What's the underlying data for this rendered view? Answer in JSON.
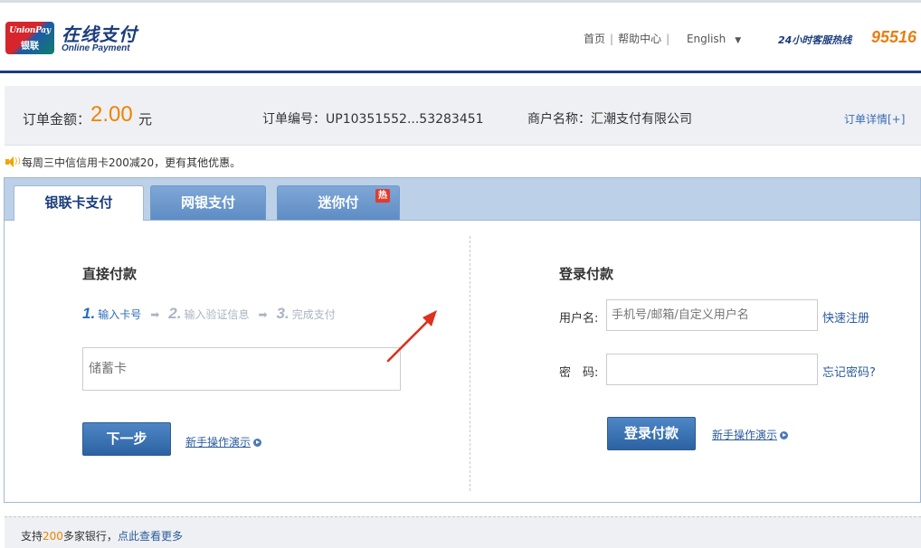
{
  "header": {
    "logo_en": "UnionPay",
    "logo_cn": "银联",
    "brand_cn": "在线支付",
    "brand_en": "Online Payment",
    "nav": {
      "home": "首页",
      "help": "帮助中心",
      "language": "English"
    },
    "hotline_label": "24小时客服热线",
    "hotline_number": "95516"
  },
  "order": {
    "amount_label": "订单金额：",
    "amount": "2.00",
    "unit": "元",
    "order_no": "订单编号：UP10351552...53283451",
    "merchant": "商户名称：汇潮支付有限公司",
    "detail_link": "订单详情[+]"
  },
  "promo": {
    "text": "每周三中信信用卡200减20，更有其他优惠。"
  },
  "tabs": [
    {
      "label": "银联卡支付",
      "active": true
    },
    {
      "label": "网银支付",
      "active": false
    },
    {
      "label": "迷你付",
      "active": false,
      "badge": "热"
    }
  ],
  "direct_pay": {
    "title": "直接付款",
    "steps": [
      {
        "num": "1.",
        "label": "输入卡号"
      },
      {
        "num": "2.",
        "label": "输入验证信息"
      },
      {
        "num": "3.",
        "label": "完成支付"
      }
    ],
    "card_placeholder": "储蓄卡",
    "next_button": "下一步",
    "guide_link": "新手操作演示"
  },
  "login_pay": {
    "title": "登录付款",
    "username_label": "用户名:",
    "username_placeholder": "手机号/邮箱/自定义用户名",
    "register_link": "快速注册",
    "password_label": "密　码:",
    "forgot_link": "忘记密码?",
    "login_button": "登录付款",
    "guide_link": "新手操作演示"
  },
  "footer": {
    "prefix": "支持",
    "count": "200",
    "suffix": "多家银行，",
    "more_link": "点此查看更多"
  },
  "colors": {
    "brand_blue": "#1a3d7c",
    "accent_orange": "#f08300",
    "link_blue": "#2b5b9c",
    "annotation_red": "#e0301e"
  }
}
